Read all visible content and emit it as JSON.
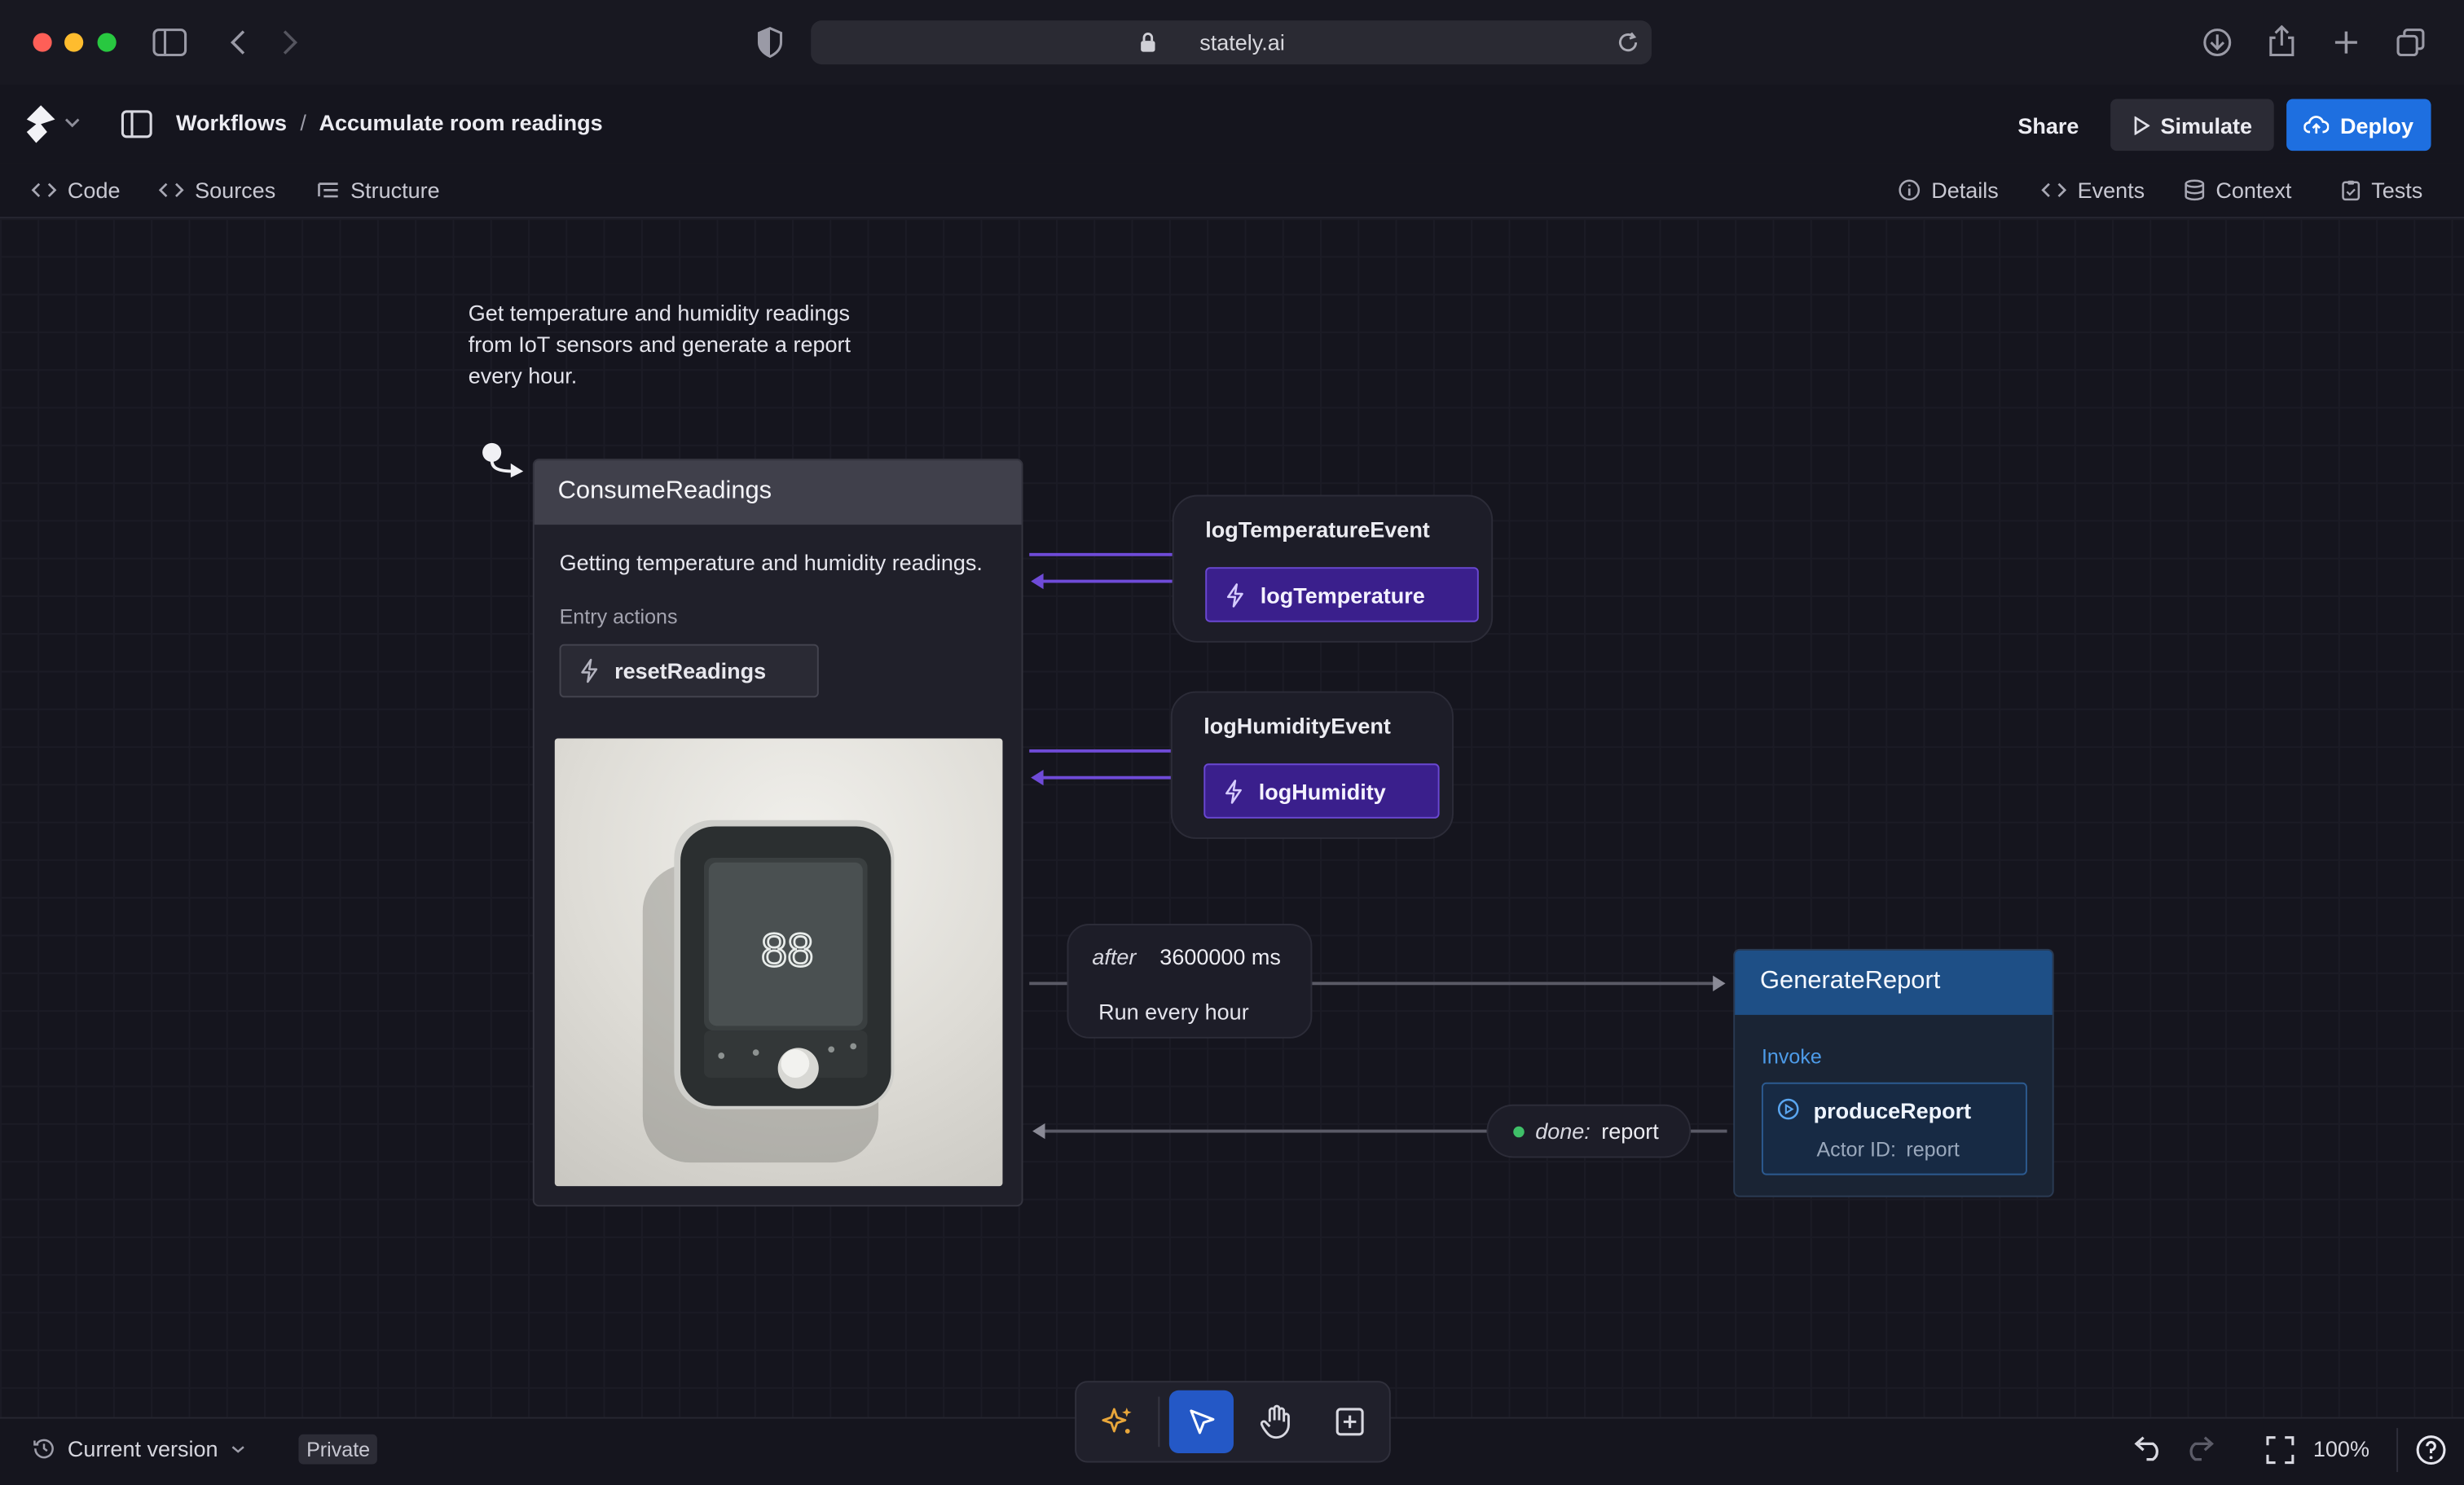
{
  "browser": {
    "url": "stately.ai"
  },
  "header": {
    "breadcrumb_root": "Workflows",
    "breadcrumb_separator": "/",
    "page_title": "Accumulate room readings",
    "share_label": "Share",
    "simulate_label": "Simulate",
    "deploy_label": "Deploy",
    "deploy_color": "#1e6fe0"
  },
  "toolbar": {
    "left_tabs": [
      {
        "label": "Code",
        "icon": "code-icon"
      },
      {
        "label": "Sources",
        "icon": "code-icon"
      },
      {
        "label": "Structure",
        "icon": "structure-icon"
      }
    ],
    "right_tabs": [
      {
        "label": "Details",
        "icon": "info-icon"
      },
      {
        "label": "Events",
        "icon": "code-icon"
      },
      {
        "label": "Context",
        "icon": "database-icon"
      },
      {
        "label": "Tests",
        "icon": "clipboard-icon"
      }
    ]
  },
  "canvas": {
    "machine_description_lines": [
      "Get temperature and humidity readings",
      "from IoT sensors and generate a report",
      "every hour."
    ],
    "consume_state": {
      "title": "ConsumeReadings",
      "description": "Getting temperature and humidity readings.",
      "entry_actions_label": "Entry actions",
      "entry_action": "resetReadings",
      "image_display": "88"
    },
    "temperature_event": {
      "name": "logTemperatureEvent",
      "action": "logTemperature"
    },
    "humidity_event": {
      "name": "logHumidityEvent",
      "action": "logHumidity"
    },
    "delayed_transition": {
      "keyword": "after",
      "delay": "3600000 ms",
      "description": "Run every hour"
    },
    "done_transition": {
      "keyword": "done:",
      "target": "report"
    },
    "generate_state": {
      "title": "GenerateReport",
      "invoke_label": "Invoke",
      "actor_name": "produceReport",
      "actor_id_label": "Actor ID:",
      "actor_id": "report"
    },
    "colors": {
      "event_action_bg": "#3a1f8c",
      "event_edge": "#6f4bd8",
      "state_header_blue": "#1e4f86"
    }
  },
  "footer": {
    "version_label": "Current version",
    "visibility_badge": "Private",
    "zoom": "100%"
  }
}
